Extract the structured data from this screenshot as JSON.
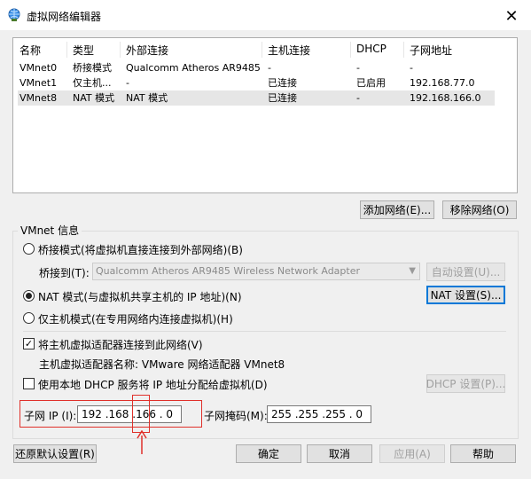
{
  "window": {
    "title": "虚拟网络编辑器",
    "close_glyph": "✕"
  },
  "table": {
    "headers": [
      "名称",
      "类型",
      "外部连接",
      "主机连接",
      "DHCP",
      "子网地址"
    ],
    "rows": [
      [
        "VMnet0",
        "桥接模式",
        "Qualcomm Atheros AR9485 ...",
        "-",
        "-",
        "-"
      ],
      [
        "VMnet1",
        "仅主机...",
        "-",
        "已连接",
        "已启用",
        "192.168.77.0"
      ],
      [
        "VMnet8",
        "NAT 模式",
        "NAT 模式",
        "已连接",
        "-",
        "192.168.166.0"
      ]
    ],
    "selected_row": 2
  },
  "buttons": {
    "add_network": "添加网络(E)...",
    "remove_network": "移除网络(O)",
    "auto_settings": "自动设置(U)...",
    "nat_settings": "NAT 设置(S)...",
    "dhcp_settings": "DHCP 设置(P)...",
    "restore_defaults": "还原默认设置(R)",
    "ok": "确定",
    "cancel": "取消",
    "apply": "应用(A)",
    "help": "帮助"
  },
  "vmnet_info": {
    "group_label": "VMnet 信息",
    "bridged_label": "桥接模式(将虚拟机直接连接到外部网络)(B)",
    "bridged_to_label": "桥接到(T):",
    "bridged_to_value": "Qualcomm Atheros AR9485 Wireless Network Adapter",
    "nat_label": "NAT 模式(与虚拟机共享主机的 IP 地址)(N)",
    "hostonly_label": "仅主机模式(在专用网络内连接虚拟机)(H)",
    "selected_mode": "nat",
    "connect_adapter_label": "将主机虚拟适配器连接到此网络(V)",
    "connect_adapter_checked": true,
    "adapter_name_label": "主机虚拟适配器名称: VMware 网络适配器 VMnet8",
    "use_dhcp_label": "使用本地 DHCP 服务将 IP 地址分配给虚拟机(D)",
    "use_dhcp_checked": false,
    "subnet_ip_label": "子网 IP (I):",
    "subnet_ip_value": "192 .168 .166 . 0",
    "subnet_mask_label": "子网掩码(M):",
    "subnet_mask_value": "255 .255 .255 . 0"
  },
  "colors": {
    "annotation_red": "#e0302a",
    "focus_blue": "#0078d7"
  }
}
